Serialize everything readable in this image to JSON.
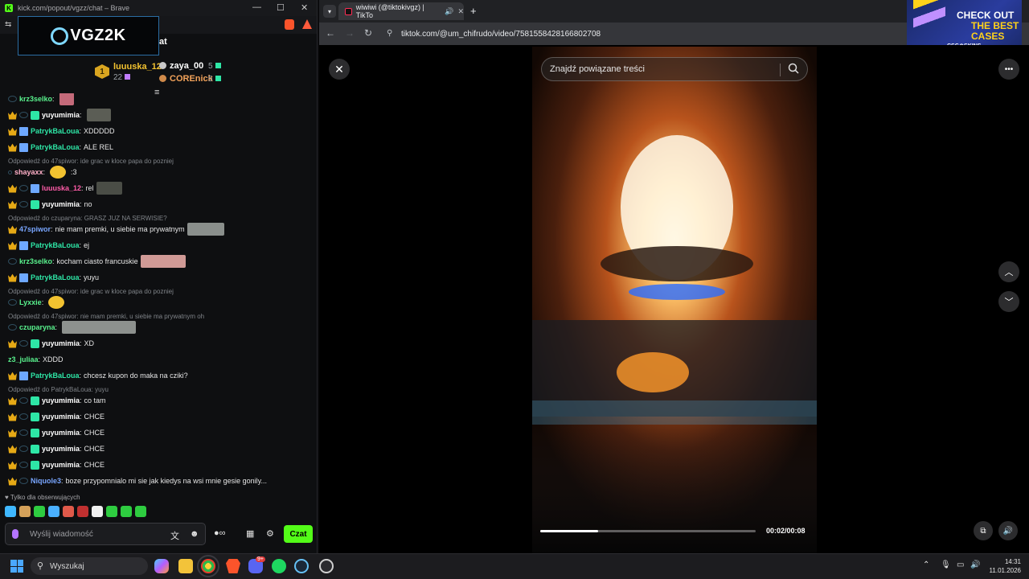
{
  "kick_window": {
    "title": "kick.com/popout/vgzz/chat – Brave",
    "logo_text": "VGZ2K",
    "chat_header_fragment": "at",
    "leaderboard": {
      "rank": "1",
      "first": {
        "name": "luuuska_12",
        "value": "22"
      },
      "others": [
        {
          "name": "zaya_00",
          "value": "5"
        },
        {
          "name": "COREnick",
          "value": "5"
        }
      ]
    },
    "messages": [
      {
        "type": "msg",
        "user": "krz3selko",
        "text": "",
        "color": "#59f28d",
        "badges": [
          "ghost"
        ],
        "emote": "#c46a7a",
        "emote_w": 18
      },
      {
        "type": "msg",
        "user": "yuyumimia",
        "text": "",
        "color": "#ffffff",
        "badges": [
          "crown",
          "ghost",
          "sub"
        ],
        "emote": "#5b5d55",
        "emote_w": 30
      },
      {
        "type": "msg",
        "user": "PatrykBaLoua",
        "text": "XDDDDD",
        "color": "#2ee6a6",
        "badges": [
          "crown",
          "boost"
        ]
      },
      {
        "type": "msg",
        "user": "PatrykBaLoua",
        "text": "ALE REL",
        "color": "#2ee6a6",
        "badges": [
          "crown",
          "boost"
        ]
      },
      {
        "type": "reply",
        "text": "Odpowiedź do 47spiwor: ide grac w kloce papa do pozniej"
      },
      {
        "type": "msg",
        "user": "shayaxx",
        "text": ":3",
        "color": "#ffb0c8",
        "badges": [
          "dot"
        ],
        "emote": "#f2c230",
        "emote_w": 20
      },
      {
        "type": "msg",
        "user": "luuuska_12",
        "text": "rel",
        "color": "#ff5ca8",
        "badges": [
          "crown",
          "ghost",
          "boost"
        ],
        "emote": "#4a4d46",
        "emote_w": 32
      },
      {
        "type": "msg",
        "user": "yuyumimia",
        "text": "no",
        "color": "#ffffff",
        "badges": [
          "crown",
          "ghost",
          "sub"
        ]
      },
      {
        "type": "reply",
        "text": "Odpowiedź do czuparyna: GRASZ JUZ NA SERWISIE?"
      },
      {
        "type": "msg",
        "user": "47spiwor",
        "text": "nie mam premki, u siebie ma prywatnym",
        "color": "#79a6ff",
        "badges": [
          "crown"
        ],
        "emote": "#8a8f8c",
        "emote_w": 46
      },
      {
        "type": "msg",
        "user": "PatrykBaLoua",
        "text": "ej",
        "color": "#2ee6a6",
        "badges": [
          "crown",
          "boost"
        ]
      },
      {
        "type": "msg",
        "user": "krz3selko",
        "text": "kocham ciasto francuskie",
        "color": "#59f28d",
        "badges": [
          "ghost"
        ],
        "emote": "#d09a96",
        "emote_w": 56
      },
      {
        "type": "msg",
        "user": "PatrykBaLoua",
        "text": "yuyu",
        "color": "#2ee6a6",
        "badges": [
          "crown",
          "boost"
        ]
      },
      {
        "type": "reply",
        "text": "Odpowiedź do 47spiwor: ide grac w kloce papa do pozniej"
      },
      {
        "type": "msg",
        "user": "Lyxxie",
        "text": "",
        "color": "#59f28d",
        "badges": [
          "ghost"
        ],
        "emote": "#f2c230",
        "emote_w": 20
      },
      {
        "type": "reply",
        "text": "Odpowiedź do 47spiwor: nie mam premki, u siebie ma prywatnym oh"
      },
      {
        "type": "msg",
        "user": "czuparyna",
        "text": "",
        "color": "#59f28d",
        "badges": [
          "ghost"
        ],
        "emote": "#8d918e",
        "emote_w": 92
      },
      {
        "type": "msg",
        "user": "yuyumimia",
        "text": "XD",
        "color": "#ffffff",
        "badges": [
          "crown",
          "ghost",
          "sub"
        ]
      },
      {
        "type": "msg",
        "user": "z3_juliaa",
        "text": "XDDD",
        "color": "#59f28d",
        "badges": []
      },
      {
        "type": "msg",
        "user": "PatrykBaLoua",
        "text": "chcesz kupon do maka na cziki?",
        "color": "#2ee6a6",
        "badges": [
          "crown",
          "boost"
        ]
      },
      {
        "type": "reply",
        "text": "Odpowiedź do PatrykBaLoua: yuyu"
      },
      {
        "type": "msg",
        "user": "yuyumimia",
        "text": "co tam",
        "color": "#ffffff",
        "badges": [
          "crown",
          "ghost",
          "sub"
        ]
      },
      {
        "type": "msg",
        "user": "yuyumimia",
        "text": "CHCE",
        "color": "#ffffff",
        "badges": [
          "crown",
          "ghost",
          "sub"
        ]
      },
      {
        "type": "msg",
        "user": "yuyumimia",
        "text": "CHCE",
        "color": "#ffffff",
        "badges": [
          "crown",
          "ghost",
          "sub"
        ]
      },
      {
        "type": "msg",
        "user": "yuyumimia",
        "text": "CHCE",
        "color": "#ffffff",
        "badges": [
          "crown",
          "ghost",
          "sub"
        ]
      },
      {
        "type": "msg",
        "user": "yuyumimia",
        "text": "CHCE",
        "color": "#ffffff",
        "badges": [
          "crown",
          "ghost",
          "sub"
        ]
      },
      {
        "type": "msg",
        "user": "Niquole3",
        "text": "boze przypomnialo mi sie jak kiedys na wsi mnie gesie gonily...",
        "color": "#79a6ff",
        "badges": [
          "crown",
          "ghost"
        ]
      }
    ],
    "follow_note": "Tylko dla obserwujących",
    "input_placeholder": "Wyślij wiadomość",
    "send_label": "Czat",
    "emote_colors": [
      "#3fb8ff",
      "#d4a15a",
      "#2ecc40",
      "#4ab0ff",
      "#e05a4a",
      "#c03030",
      "#f0f0f0",
      "#2ecc40",
      "#2ecc40",
      "#2ecc40"
    ]
  },
  "browser": {
    "tab_title": "wiwiwi (@tiktokivgz) | TikTo",
    "url": "tiktok.com/@um_chifrudo/video/7581558428166802708",
    "ad": {
      "line1": "CHECK OUT",
      "line2": "THE BEST",
      "line3": "CASES",
      "brand": "CSG⊕SKINS"
    },
    "search_placeholder": "Znajdź powiązane treści",
    "time": "00:02/00:08",
    "progress_fraction": 0.27
  },
  "taskbar": {
    "search_label": "Wyszukaj",
    "time": "14:31",
    "date": "11.01.2026",
    "discord_badge": "9+"
  }
}
